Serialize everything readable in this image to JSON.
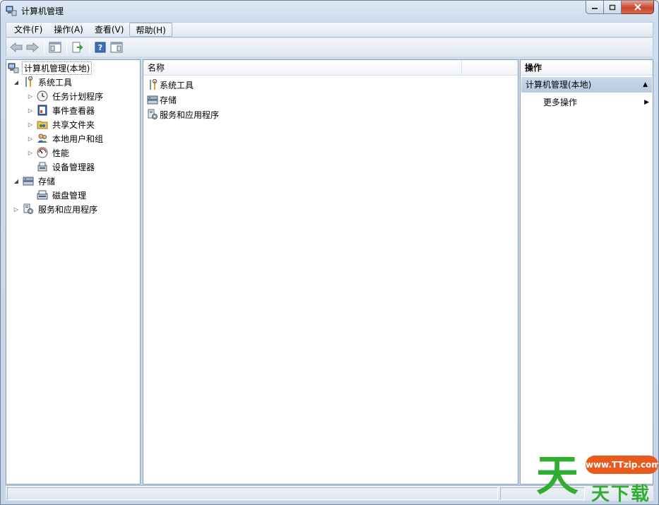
{
  "window": {
    "title": "计算机管理"
  },
  "menubar": {
    "items": [
      {
        "label": "文件(F)"
      },
      {
        "label": "操作(A)"
      },
      {
        "label": "查看(V)"
      },
      {
        "label": "帮助(H)"
      }
    ]
  },
  "tree": {
    "items": [
      {
        "label": "计算机管理(本地)",
        "icon": "computer-management-icon"
      },
      {
        "label": "系统工具",
        "icon": "system-tools-icon"
      },
      {
        "label": "任务计划程序",
        "icon": "clock-icon"
      },
      {
        "label": "事件查看器",
        "icon": "event-viewer-icon"
      },
      {
        "label": "共享文件夹",
        "icon": "shared-folder-icon"
      },
      {
        "label": "本地用户和组",
        "icon": "users-icon"
      },
      {
        "label": "性能",
        "icon": "performance-icon"
      },
      {
        "label": "设备管理器",
        "icon": "device-manager-icon"
      },
      {
        "label": "存储",
        "icon": "storage-icon"
      },
      {
        "label": "磁盘管理",
        "icon": "disk-icon"
      },
      {
        "label": "服务和应用程序",
        "icon": "services-icon"
      }
    ]
  },
  "list": {
    "column_name": "名称",
    "rows": [
      {
        "label": "系统工具",
        "icon": "system-tools-icon"
      },
      {
        "label": "存储",
        "icon": "storage-icon"
      },
      {
        "label": "服务和应用程序",
        "icon": "services-icon"
      }
    ]
  },
  "actions": {
    "header": "操作",
    "section": "计算机管理(本地)",
    "more": "更多操作"
  },
  "watermark": {
    "big": "天",
    "pill": "www.TTzip.com",
    "tail": "天下载"
  },
  "colors": {
    "accent": "#b6c9e0",
    "watermark_green": "#2fae2f",
    "watermark_orange": "#ea5a1c"
  }
}
